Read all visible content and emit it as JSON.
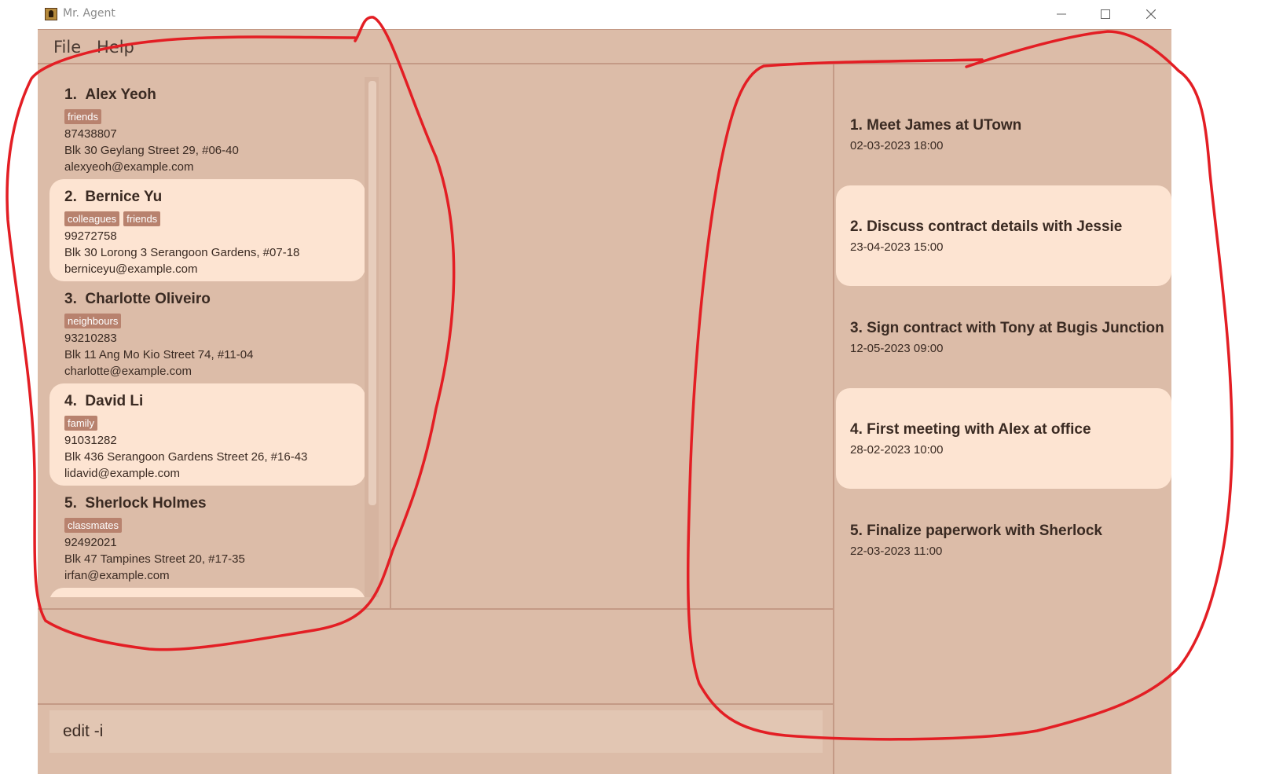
{
  "window": {
    "title": "Mr. Agent",
    "controls": [
      "minimize",
      "maximize",
      "close"
    ]
  },
  "menu": [
    "File",
    "Help"
  ],
  "persons": [
    {
      "index": "1.",
      "name": "Alex Yeoh",
      "tags": [
        "friends"
      ],
      "phone": "87438807",
      "address": "Blk 30 Geylang Street 29, #06-40",
      "email": "alexyeoh@example.com"
    },
    {
      "index": "2.",
      "name": "Bernice Yu",
      "tags": [
        "colleagues",
        "friends"
      ],
      "phone": "99272758",
      "address": "Blk 30 Lorong 3 Serangoon Gardens, #07-18",
      "email": "berniceyu@example.com"
    },
    {
      "index": "3.",
      "name": "Charlotte Oliveiro",
      "tags": [
        "neighbours"
      ],
      "phone": "93210283",
      "address": "Blk 11 Ang Mo Kio Street 74, #11-04",
      "email": "charlotte@example.com"
    },
    {
      "index": "4.",
      "name": "David Li",
      "tags": [
        "family"
      ],
      "phone": "91031282",
      "address": "Blk 436 Serangoon Gardens Street 26, #16-43",
      "email": "lidavid@example.com"
    },
    {
      "index": "5.",
      "name": "Sherlock Holmes",
      "tags": [
        "classmates"
      ],
      "phone": "92492021",
      "address": "Blk 47 Tampines Street 20, #17-35",
      "email": "irfan@example.com"
    }
  ],
  "meetings": [
    {
      "title": "1. Meet James at UTown",
      "datetime": "02-03-2023 18:00"
    },
    {
      "title": "2. Discuss contract details with Jessie",
      "datetime": "23-04-2023 15:00"
    },
    {
      "title": "3. Sign contract with Tony at Bugis Junction",
      "datetime": "12-05-2023 09:00"
    },
    {
      "title": "4. First meeting with Alex at office",
      "datetime": "28-02-2023 10:00"
    },
    {
      "title": "5. Finalize paperwork with Sherlock",
      "datetime": "22-03-2023 11:00"
    }
  ],
  "command_box": {
    "value": "edit -i"
  },
  "colors": {
    "background": "#dcbca8",
    "card_alt": "#fde4d2",
    "tag": "#b8826e",
    "annotation": "#e31e24"
  }
}
